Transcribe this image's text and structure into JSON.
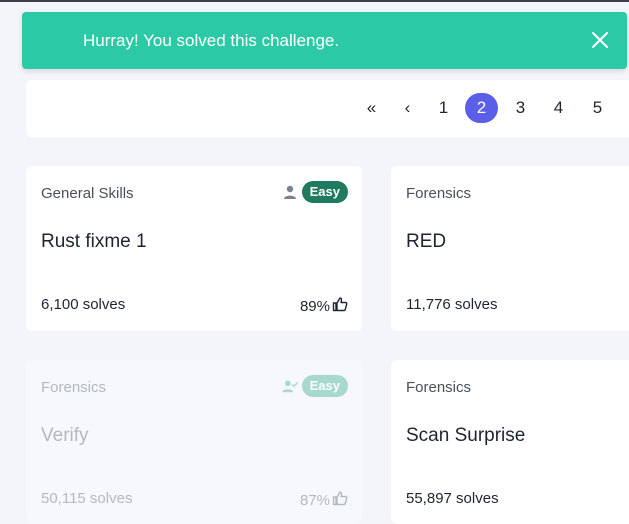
{
  "toast": {
    "message": "Hurray! You solved this challenge."
  },
  "pagination": {
    "first": "«",
    "prev": "‹",
    "pages": [
      "1",
      "2",
      "3",
      "4",
      "5"
    ],
    "current": "2"
  },
  "cards": [
    {
      "category": "General Skills",
      "title": "Rust fixme 1",
      "solves": "6,100 solves",
      "rating": "89%",
      "difficulty": "Easy",
      "solved": false
    },
    {
      "category": "Forensics",
      "title": "RED",
      "solves": "11,776 solves"
    },
    {
      "category": "Forensics",
      "title": "Verify",
      "solves": "50,115 solves",
      "rating": "87%",
      "difficulty": "Easy",
      "solved": true
    },
    {
      "category": "Forensics",
      "title": "Scan Surprise",
      "solves": "55,897 solves"
    }
  ],
  "colors": {
    "toast": "#2bc9a6",
    "active_page": "#5b5fe8",
    "easy_badge": "#1f7a5f"
  }
}
